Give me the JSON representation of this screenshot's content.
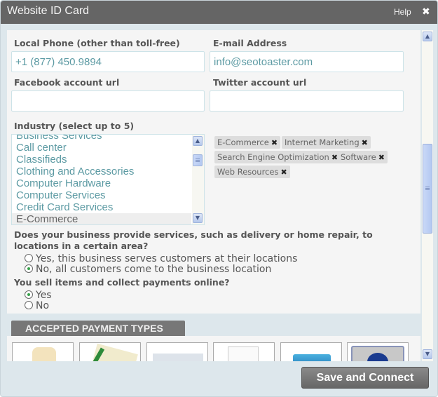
{
  "window": {
    "title": "Website ID Card",
    "help_label": "Help",
    "close_glyph": "✖"
  },
  "fields": {
    "local_phone": {
      "label": "Local Phone (other than toll-free)",
      "value": "+1 (877) 450.9894"
    },
    "email": {
      "label": "E-mail Address",
      "value": "info@seotoaster.com"
    },
    "facebook": {
      "label": "Facebook account url",
      "value": ""
    },
    "twitter": {
      "label": "Twitter account url",
      "value": ""
    }
  },
  "industry": {
    "label": "Industry (select up to 5)",
    "options": [
      "Business Services",
      "Call center",
      "Classifieds",
      "Clothing and Accessories",
      "Computer Hardware",
      "Computer Services",
      "Credit Card Services",
      "E-Commerce"
    ],
    "highlighted": "E-Commerce",
    "selected_tags": [
      "E-Commerce",
      "Internet Marketing",
      "Search Engine Optimization",
      "Software",
      "Web Resources"
    ],
    "tag_remove_glyph": "✖"
  },
  "service_area": {
    "question": "Does your business provide services, such as delivery or home repair, to locations in a certain area?",
    "options": [
      {
        "label": "Yes, this business serves customers at their locations",
        "checked": false
      },
      {
        "label": "No, all customers come to the business location",
        "checked": true
      }
    ]
  },
  "online_payments": {
    "question": "You sell items and collect payments online?",
    "options": [
      {
        "label": "Yes",
        "checked": true
      },
      {
        "label": "No",
        "checked": false
      }
    ]
  },
  "payment_types": {
    "header": "ACCEPTED PAYMENT TYPES",
    "tiles": [
      "cash",
      "check",
      "card",
      "invoice",
      "bank-card",
      "diners-club"
    ]
  },
  "footer": {
    "save_label": "Save and Connect"
  },
  "scroll_glyphs": {
    "up": "▲",
    "down": "▼"
  }
}
